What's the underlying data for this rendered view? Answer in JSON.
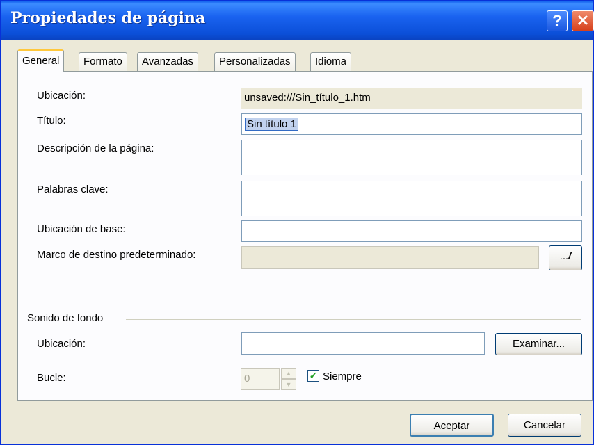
{
  "window": {
    "title": "Propiedades de página",
    "help_label": "?",
    "close_label": "✕"
  },
  "tabs": [
    {
      "label": "General",
      "active": true
    },
    {
      "label": "Formato"
    },
    {
      "label": "Avanzadas"
    },
    {
      "label": "Personalizadas"
    },
    {
      "label": "Idioma"
    }
  ],
  "general": {
    "location_label": "Ubicación:",
    "location_value": "unsaved:///Sin_título_1.htm",
    "title_label": "Título:",
    "title_value": "Sin título 1",
    "description_label": "Descripción de la página:",
    "description_value": "",
    "keywords_label": "Palabras clave:",
    "keywords_value": "",
    "base_label": "Ubicación de base:",
    "base_value": "",
    "target_frame_label": "Marco de destino predeterminado:",
    "target_frame_value": "",
    "target_frame_button": "..."
  },
  "background_sound": {
    "group_label": "Sonido de fondo",
    "location_label": "Ubicación:",
    "location_value": "",
    "browse_button": "Examinar...",
    "loop_label": "Bucle:",
    "loop_value": "0",
    "always_label": "Siempre",
    "always_checked": true
  },
  "footer": {
    "ok_button": "Aceptar",
    "cancel_button": "Cancelar"
  },
  "icons": {
    "help": "question-icon",
    "close": "close-icon",
    "edit": "pencil-icon",
    "spin_up": "up-arrow-icon",
    "spin_down": "down-arrow-icon",
    "check": "checkmark-icon"
  }
}
